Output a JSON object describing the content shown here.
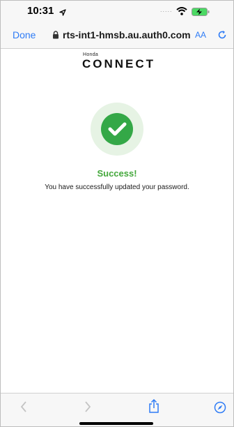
{
  "status_bar": {
    "time": "10:31",
    "signal": "....."
  },
  "toolbar": {
    "done_label": "Done",
    "url": "rts-int1-hmsb.au.auth0.com",
    "text_size_label": "AA"
  },
  "page": {
    "logo_small": "Honda",
    "logo_main": "CONNECT",
    "success_title": "Success!",
    "success_message": "You have successfully updated your password."
  },
  "colors": {
    "accent": "#2f7cf6",
    "success": "#44a83c",
    "badge_bg": "#e6f3e4"
  },
  "icons": {
    "location": "location-arrow-icon",
    "wifi": "wifi-icon",
    "battery": "battery-charging-icon",
    "lock": "lock-icon",
    "reload": "reload-icon",
    "back": "chevron-left-icon",
    "forward": "chevron-right-icon",
    "share": "share-icon",
    "safari": "compass-icon",
    "check": "checkmark-icon"
  }
}
